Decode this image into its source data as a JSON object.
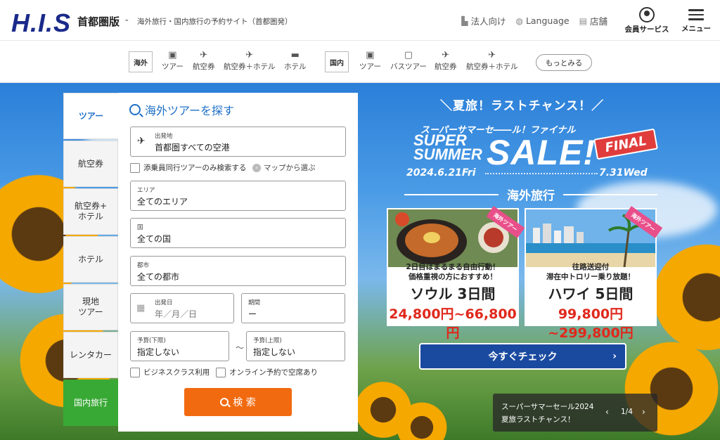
{
  "header": {
    "logo": "H.I.S",
    "region": "首都圏版",
    "tagline": "海外旅行・国内旅行の予約サイト（首都圏発）",
    "links": [
      {
        "icon": "building-icon",
        "label": "法人向け"
      },
      {
        "icon": "globe-icon",
        "label": "Language"
      },
      {
        "icon": "store-icon",
        "label": "店舗"
      }
    ],
    "member_label": "会員サービス",
    "menu_label": "メニュー"
  },
  "catnav": {
    "overseas_label": "海外",
    "overseas_items": [
      "ツアー",
      "航空券",
      "航空券＋ホテル",
      "ホテル"
    ],
    "domestic_label": "国内",
    "domestic_items": [
      "ツアー",
      "バスツアー",
      "航空券",
      "航空券＋ホテル"
    ],
    "more_label": "もっとみる"
  },
  "tabs": [
    "ツアー",
    "航空券",
    "航空券+\nホテル",
    "ホテル",
    "現地\nツアー",
    "レンタカー",
    "国内旅行"
  ],
  "search": {
    "title": "海外ツアーを探す",
    "departure_label": "出発地",
    "departure_value": "首都圏すべての空港",
    "companion_check": "添乗員同行ツアーのみ検索する",
    "map_link": "マップから選ぶ",
    "area_label": "エリア",
    "area_value": "全てのエリア",
    "country_label": "国",
    "country_value": "全ての国",
    "city_label": "都市",
    "city_value": "全ての都市",
    "date_label": "出発日",
    "date_placeholder": "年／月／日",
    "period_label": "期間",
    "period_value": "ー",
    "budget_min_label": "予算(下限)",
    "budget_min_value": "指定しない",
    "budget_max_label": "予算(上限)",
    "budget_max_value": "指定しない",
    "tilde": "〜",
    "business_check": "ビジネスクラス利用",
    "online_check": "オンライン予約で空席あり",
    "search_button": "検 索"
  },
  "promo": {
    "headline": "＼夏旅！ラストチャンス！／",
    "sub": "スーパーサマーセ――ル！ファイナル",
    "super": "SUPER",
    "summer": "SUMMER",
    "sale": "SALE!",
    "final": "FINAL",
    "date_start": "2024.6.21Fri",
    "date_end": "7.31Wed",
    "section": "海外旅行",
    "cards": [
      {
        "ribbon": "海外ツアー",
        "line1": "2日目はまるまる自由行動！",
        "line2": "価格重視の方におすすめ！",
        "dest": "ソウル 3日間",
        "price": "24,800円~66,800円"
      },
      {
        "ribbon": "海外ツアー",
        "line1": "往路送迎付",
        "line2": "滞在中トロリー乗り放題！",
        "dest": "ハワイ 5日間",
        "price": "99,800円~299,800円"
      }
    ],
    "check_button": "今すぐチェック"
  },
  "carousel": {
    "line1": "スーパーサマーセール2024",
    "line2": "夏旅ラストチャンス！",
    "counter": "1/4"
  }
}
